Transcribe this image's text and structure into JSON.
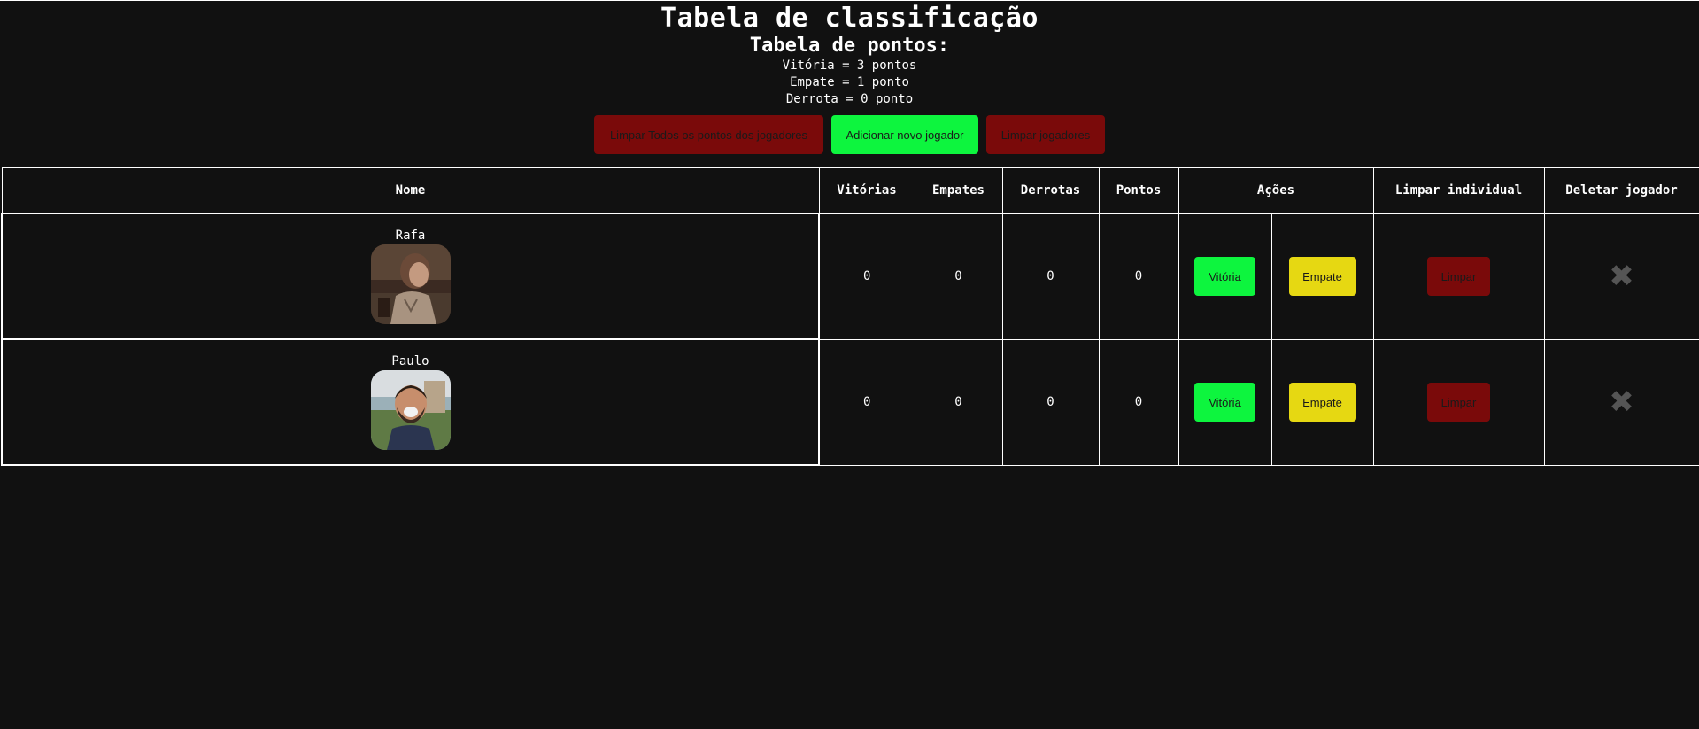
{
  "header": {
    "title": "Tabela de classificação",
    "subtitle": "Tabela de pontos:",
    "rules": [
      "Vitória = 3 pontos",
      "Empate = 1 ponto",
      "Derrota = 0 ponto"
    ]
  },
  "toolbar": {
    "clear_all_points_label": "Limpar Todos os pontos dos jogadores",
    "add_player_label": "Adicionar novo jogador",
    "clear_players_label": "Limpar jogadores"
  },
  "table": {
    "columns": {
      "name": "Nome",
      "wins": "Vitórias",
      "draws": "Empates",
      "losses": "Derrotas",
      "points": "Pontos",
      "actions": "Ações",
      "clear_individual": "Limpar individual",
      "delete_player": "Deletar jogador"
    },
    "rows": [
      {
        "name": "Rafa",
        "wins": "0",
        "draws": "0",
        "losses": "0",
        "points": "0",
        "win_label": "Vitória",
        "draw_label": "Empate",
        "clear_label": "Limpar",
        "delete_icon": "close-x-icon"
      },
      {
        "name": "Paulo",
        "wins": "0",
        "draws": "0",
        "losses": "0",
        "points": "0",
        "win_label": "Vitória",
        "draw_label": "Empate",
        "clear_label": "Limpar",
        "delete_icon": "close-x-icon"
      }
    ]
  },
  "colors": {
    "background": "#111111",
    "win_button": "#0df53e",
    "draw_button": "#e6d812",
    "clear_button": "#7a0a0a",
    "delete_icon": "#555555"
  }
}
